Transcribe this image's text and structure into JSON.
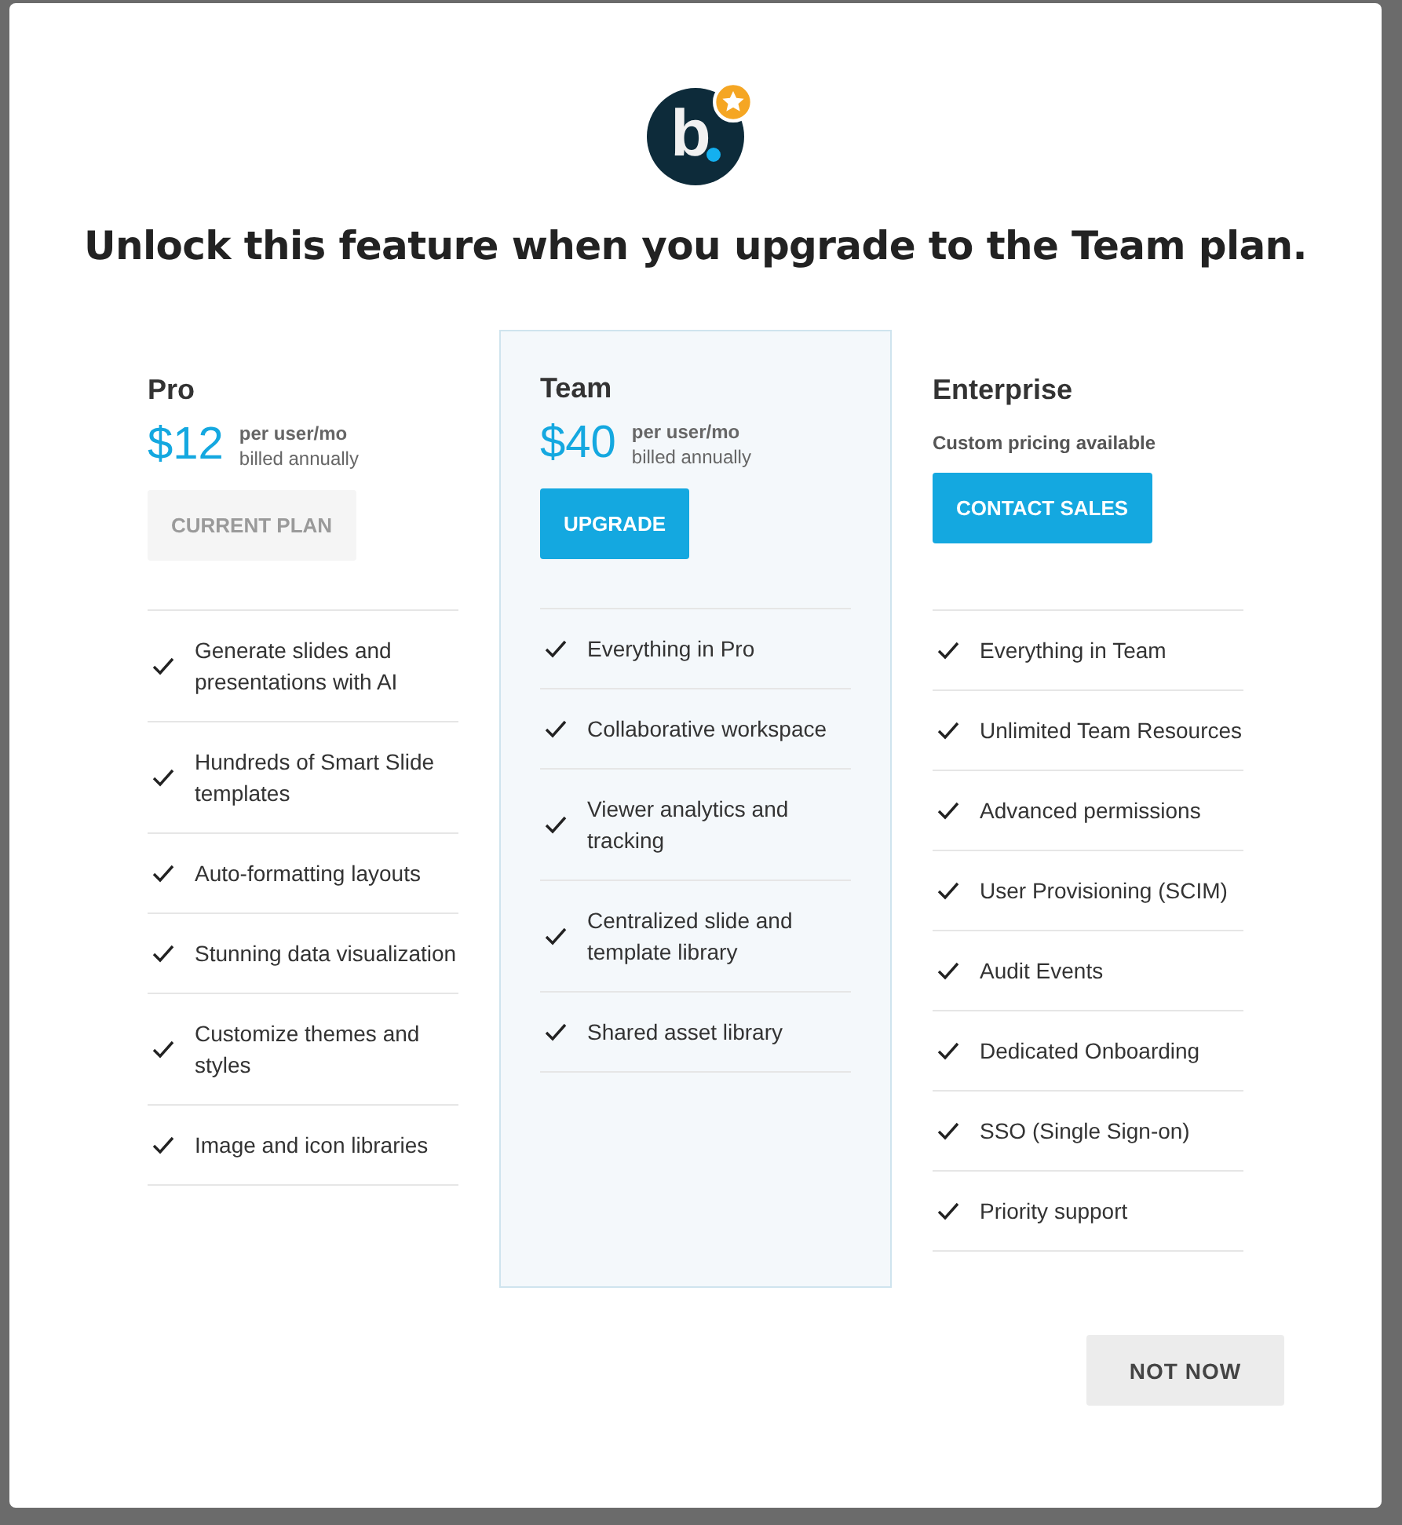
{
  "dialog": {
    "title": "Unlock this feature when you upgrade to the Team plan.",
    "logo_letter": "b"
  },
  "plans": [
    {
      "name": "Pro",
      "selected": false,
      "price": "$12",
      "price_unit": "per user/mo",
      "billing": "billed annually",
      "button": {
        "label": "CURRENT PLAN",
        "disabled": true
      },
      "features": [
        "Generate slides and presentations with AI",
        "Hundreds of Smart Slide templates",
        "Auto-formatting layouts",
        "Stunning data visualization",
        "Customize themes and styles",
        "Image and icon libraries"
      ]
    },
    {
      "name": "Team",
      "selected": true,
      "price": "$40",
      "price_unit": "per user/mo",
      "billing": "billed annually",
      "button": {
        "label": "UPGRADE",
        "disabled": false
      },
      "features": [
        "Everything in Pro",
        "Collaborative workspace",
        "Viewer analytics and tracking",
        "Centralized slide and template library",
        "Shared asset library"
      ]
    },
    {
      "name": "Enterprise",
      "selected": false,
      "pricing_note": "Custom pricing available",
      "button": {
        "label": "CONTACT SALES",
        "disabled": false
      },
      "features": [
        "Everything in Team",
        "Unlimited Team Resources",
        "Advanced permissions",
        "User Provisioning (SCIM)",
        "Audit Events",
        "Dedicated Onboarding",
        "SSO (Single Sign-on)",
        "Priority support"
      ]
    }
  ],
  "footer_button": "NOT NOW"
}
